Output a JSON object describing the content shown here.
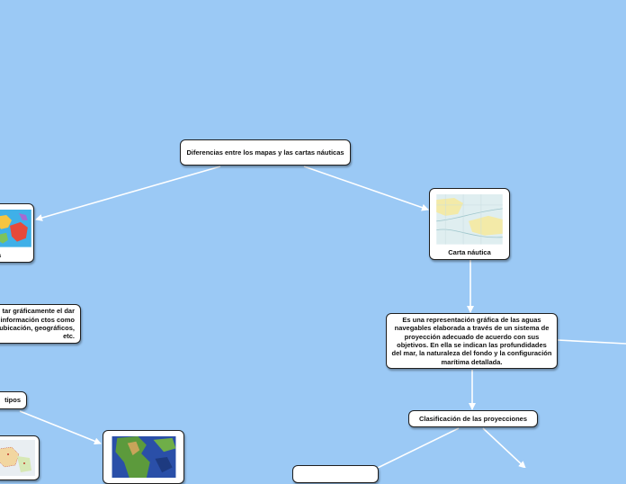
{
  "nodes": {
    "root": "Diferencias entre los mapas y las cartas náuticas",
    "mapa_label": "a",
    "carta_label": "Carta náutica",
    "carta_def": "Es una representación gráfica de las aguas navegables elaborada a través de un sistema de proyección adecuado de acuerdo con sus objetivos. En ella se indican las profundidades del mar, la naturaleza del fondo y la configuración marítima detallada.",
    "mapa_def": "tar gráficamente el dar información ctos como ubicación, geográficos, etc.",
    "tipos": "tipos",
    "clasificacion": "Clasificación de las proyecciones"
  },
  "colors": {
    "background": "#9bc9f5",
    "node_fill": "#ffffff",
    "node_border": "#1f1f1f",
    "connector": "#ffffff"
  },
  "icons": [
    "world-map-image",
    "nautical-chart-image",
    "relief-map-image",
    "regional-map-image"
  ]
}
